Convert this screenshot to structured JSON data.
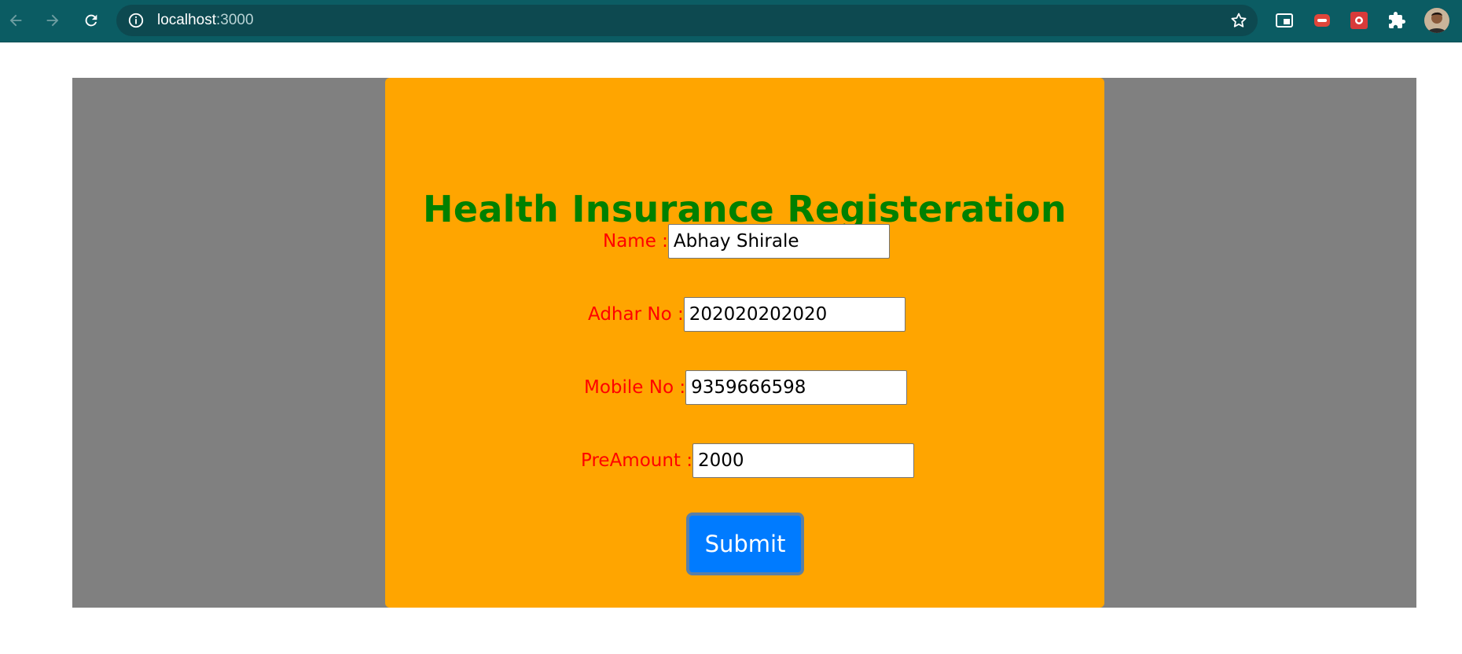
{
  "browser": {
    "url_host": "localhost",
    "url_port": ":3000",
    "icons": {
      "back": "back-arrow-icon",
      "forward": "forward-arrow-icon",
      "reload": "reload-icon",
      "info": "info-icon",
      "star": "bookmark-star-icon",
      "extensions": "puzzle-icon"
    }
  },
  "form": {
    "title": "Health Insurance Registeration",
    "fields": [
      {
        "label": "Name :",
        "value": "Abhay Shirale"
      },
      {
        "label": "Adhar No :",
        "value": "202020202020"
      },
      {
        "label": "Mobile No :",
        "value": "9359666598"
      },
      {
        "label": "PreAmount :",
        "value": "2000"
      }
    ],
    "submit_label": "Submit"
  },
  "colors": {
    "toolbar": "#0b5c63",
    "page_background": "#808080",
    "card_background": "#ffa500",
    "title": "#008000",
    "label": "#ff0000",
    "submit": "#007bff"
  }
}
